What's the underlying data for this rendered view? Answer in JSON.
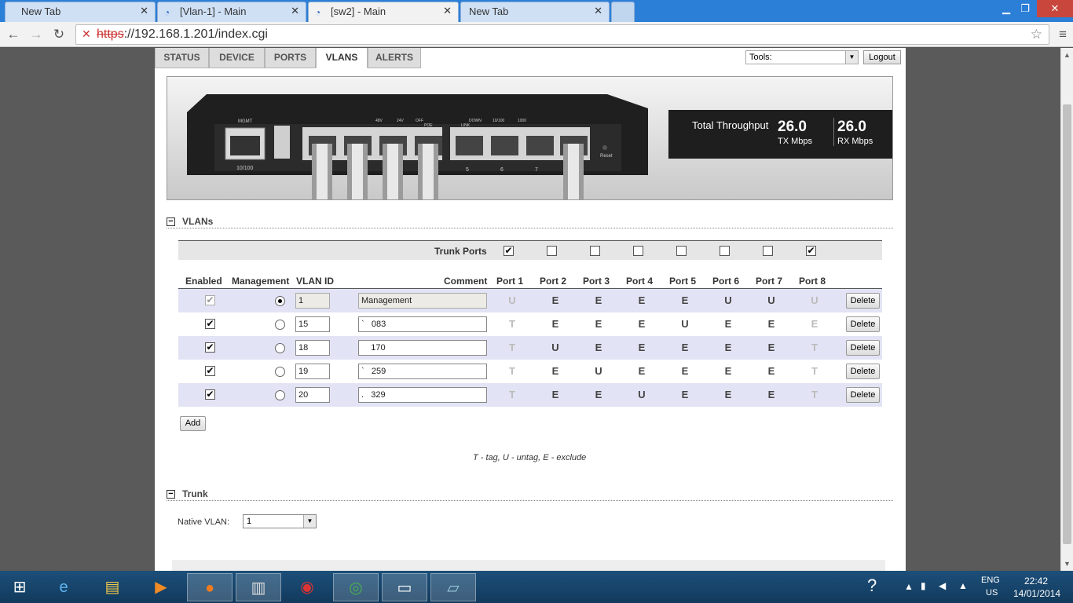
{
  "browser": {
    "tabs": [
      {
        "title": "New Tab",
        "active": false
      },
      {
        "title": "[Vlan-1] - Main",
        "active": false
      },
      {
        "title": "[sw2] - Main",
        "active": true
      },
      {
        "title": "New Tab",
        "active": false
      }
    ],
    "url_scheme": "https",
    "url_rest": "://192.168.1.201/index.cgi"
  },
  "nav": {
    "tabs": [
      "STATUS",
      "DEVICE",
      "PORTS",
      "VLANS",
      "ALERTS"
    ],
    "active_tab": "VLANS",
    "tools_label": "Tools:",
    "logout_label": "Logout"
  },
  "device": {
    "mgmt_label": "MGMT",
    "speed_label": "10/100",
    "reset_label": "Reset",
    "port_numbers": [
      "5",
      "6",
      "7"
    ],
    "led_legend": [
      "48V",
      "24V",
      "OFF",
      "POE",
      "DOWN",
      "10/100",
      "1000",
      "LINK"
    ],
    "throughput_title": "Total Throughput",
    "tx_value": "26.0",
    "tx_unit": "TX Mbps",
    "rx_value": "26.0",
    "rx_unit": "RX Mbps"
  },
  "vlans": {
    "section_title": "VLANs",
    "trunk_ports_label": "Trunk Ports",
    "trunk_ports": [
      true,
      false,
      false,
      false,
      false,
      false,
      false,
      true
    ],
    "headers": {
      "enabled": "Enabled",
      "management": "Management",
      "vlan_id": "VLAN ID",
      "comment": "Comment",
      "ports": [
        "Port 1",
        "Port 2",
        "Port 3",
        "Port 4",
        "Port 5",
        "Port 6",
        "Port 7",
        "Port 8"
      ]
    },
    "rows": [
      {
        "enabled": true,
        "management": true,
        "vlan_id": "1",
        "comment": "Management",
        "ports": [
          "U",
          "E",
          "E",
          "E",
          "E",
          "U",
          "U",
          "U"
        ],
        "light": [
          true,
          false,
          false,
          false,
          false,
          false,
          false,
          true
        ],
        "readonly": true
      },
      {
        "enabled": true,
        "management": false,
        "vlan_id": "15",
        "comment": "`   083",
        "ports": [
          "T",
          "E",
          "E",
          "E",
          "U",
          "E",
          "E",
          "E"
        ],
        "light": [
          true,
          false,
          false,
          false,
          false,
          false,
          false,
          true
        ],
        "readonly": false
      },
      {
        "enabled": true,
        "management": false,
        "vlan_id": "18",
        "comment": "    170",
        "ports": [
          "T",
          "U",
          "E",
          "E",
          "E",
          "E",
          "E",
          "T"
        ],
        "light": [
          true,
          false,
          false,
          false,
          false,
          false,
          false,
          true
        ],
        "readonly": false
      },
      {
        "enabled": true,
        "management": false,
        "vlan_id": "19",
        "comment": "`   259",
        "ports": [
          "T",
          "E",
          "U",
          "E",
          "E",
          "E",
          "E",
          "T"
        ],
        "light": [
          true,
          false,
          false,
          false,
          false,
          false,
          false,
          true
        ],
        "readonly": false
      },
      {
        "enabled": true,
        "management": false,
        "vlan_id": "20",
        "comment": ".   329",
        "ports": [
          "T",
          "E",
          "E",
          "U",
          "E",
          "E",
          "E",
          "T"
        ],
        "light": [
          true,
          false,
          false,
          false,
          false,
          false,
          false,
          true
        ],
        "readonly": false
      }
    ],
    "delete_label": "Delete",
    "add_label": "Add",
    "legend": "T - tag, U - untag, E - exclude"
  },
  "trunk": {
    "section_title": "Trunk",
    "native_vlan_label": "Native VLAN:",
    "native_vlan_value": "1"
  },
  "taskbar": {
    "lang_top": "ENG",
    "lang_bottom": "US",
    "time": "22:42",
    "date": "14/01/2014"
  },
  "colors": {
    "chrome_tabbar": "#2c7fd7",
    "row_shade": "#e2e4f5",
    "throughput_bg": "#1e1e1e"
  }
}
